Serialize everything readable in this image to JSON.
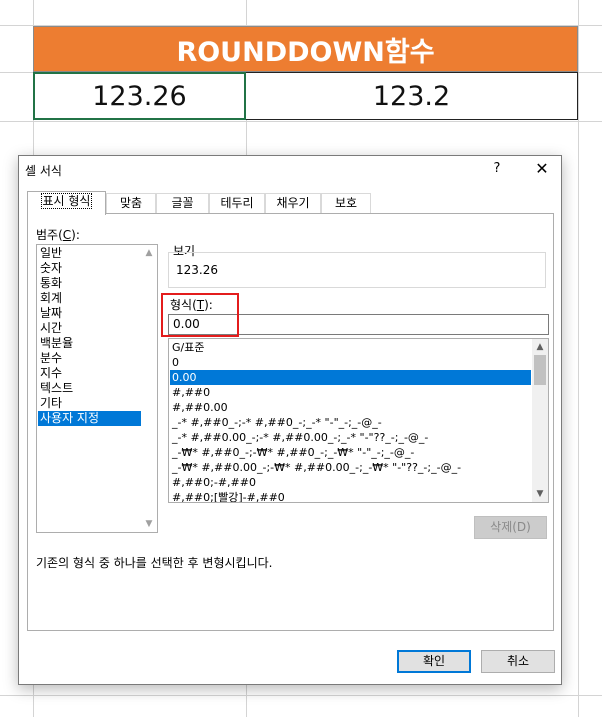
{
  "spreadsheet": {
    "title": "ROUNDDOWN함수",
    "cell_a": "123.26",
    "cell_b": "123.2",
    "header_color": "#ED7D31",
    "selection_color": "#217346"
  },
  "dialog": {
    "title": "셀 서식",
    "help": "?",
    "close": "✕",
    "tabs": [
      {
        "label": "표시 형식",
        "active": true
      },
      {
        "label": "맞춤",
        "active": false
      },
      {
        "label": "글꼴",
        "active": false
      },
      {
        "label": "테두리",
        "active": false
      },
      {
        "label": "채우기",
        "active": false
      },
      {
        "label": "보호",
        "active": false
      }
    ],
    "category_label": "범주(",
    "category_key": "C",
    "category_suffix": "):",
    "categories": [
      "일반",
      "숫자",
      "통화",
      "회계",
      "날짜",
      "시간",
      "백분율",
      "분수",
      "지수",
      "텍스트",
      "기타",
      "사용자 지정"
    ],
    "selected_category": "사용자 지정",
    "sample_label": "보기",
    "sample_value": "123.26",
    "type_label": "형식(",
    "type_key": "T",
    "type_suffix": "):",
    "type_value": "0.00",
    "formats": [
      "G/표준",
      "0",
      "0.00",
      "#,##0",
      "#,##0.00",
      "_-* #,##0_-;-* #,##0_-;_-* \"-\"_-;_-@_-",
      "_-* #,##0.00_-;-* #,##0.00_-;_-* \"-\"??_-;_-@_-",
      "_-₩* #,##0_-;-₩* #,##0_-;_-₩* \"-\"_-;_-@_-",
      "_-₩* #,##0.00_-;-₩* #,##0.00_-;_-₩* \"-\"??_-;_-@_-",
      "#,##0;-#,##0",
      "#,##0;[빨강]-#,##0"
    ],
    "selected_format": "0.00",
    "delete_button": "삭제(D)",
    "description": "기존의 형식 중 하나를 선택한 후 변형시킵니다.",
    "ok_button": "확인",
    "cancel_button": "취소",
    "accent_color": "#0078D7",
    "highlight_color": "#E31C1C"
  }
}
